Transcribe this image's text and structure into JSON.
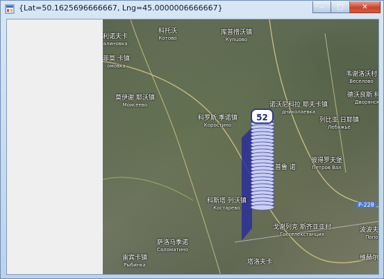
{
  "window": {
    "title": "{Lat=50.1625696666667, Lng=45.0000006666667}",
    "controls": {
      "minimize": "–",
      "maximize": "□",
      "close": "✕"
    },
    "icon": "app-window-icon"
  },
  "map": {
    "marker_count": "52",
    "places": [
      {
        "id": "kotovo",
        "zh": "科托沃",
        "ru": "Котово"
      },
      {
        "id": "kupcovo",
        "zh": "库普措沃镇",
        "ru": "Купцово"
      },
      {
        "id": "kalinovka",
        "zh": "利诺夫卡",
        "ru": "алиновка"
      },
      {
        "id": "lomovka",
        "zh": "菲莫\n卡镇",
        "ru": "омовка"
      },
      {
        "id": "moiseevo",
        "zh": "莫伊谢\n耶沃镇",
        "ru": "Моисеево"
      },
      {
        "id": "korostino",
        "zh": "科罗斯\n季诺镇",
        "ru": "Коростино"
      },
      {
        "id": "seldnikolaevka",
        "zh": "诺沃尼科拉\n耶夫卡镇",
        "ru": "дниколаевка"
      },
      {
        "id": "lebyazhie",
        "zh": "列比亚\n日耶镇",
        "ru": "Лебяжье"
      },
      {
        "id": "petrovval",
        "zh": "彼得罗夫堡",
        "ru": "Петров Вал"
      },
      {
        "id": "kostarevo",
        "zh": "科斯塔\n列沃镇",
        "ru": "Костарево"
      },
      {
        "id": "gosselekciya",
        "zh": "戈谢列克\n斯齐亚亚村",
        "ru": "Госселекстанция"
      },
      {
        "id": "salomatino",
        "zh": "萨洛马季诺",
        "ru": "Саломатино"
      },
      {
        "id": "rybinka",
        "zh": "雷宾卡镇",
        "ru": "Рыбинка"
      },
      {
        "id": "zavodskoy",
        "zh": "塔洛夫卡",
        "ru": ""
      },
      {
        "id": "veselovo",
        "zh": "韦谢洛沃村",
        "ru": "Веселово"
      },
      {
        "id": "dvoryanskoe",
        "zh": "德沃良斯\n科耶镇",
        "ru": "Дворянское"
      },
      {
        "id": "poplavskoe",
        "zh": "波波夫\n卡",
        "ru": "Попов"
      },
      {
        "id": "vaykh",
        "zh": "维赫尔\n采沃",
        "ru": ""
      },
      {
        "id": "gremyach",
        "zh": "普鲁\n诺",
        "ru": ""
      }
    ],
    "road_label": "P-228"
  }
}
